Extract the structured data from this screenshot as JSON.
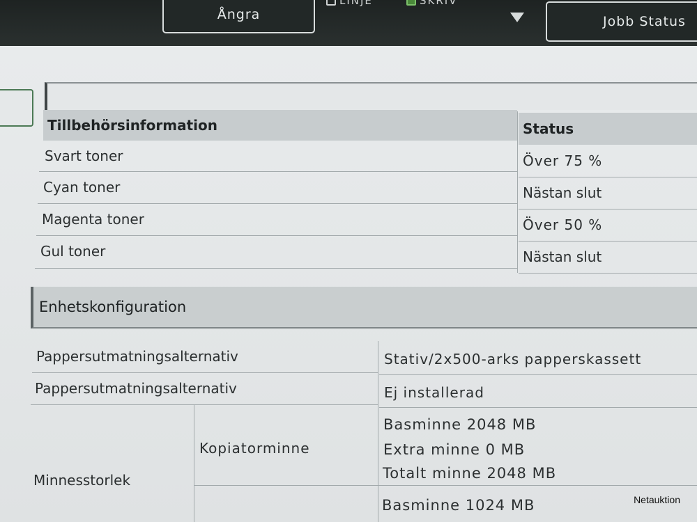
{
  "toolbar": {
    "undo_label": "Ångra",
    "mode_line_label": "LINJE",
    "mode_print_label": "SKRIV",
    "job_status_label": "Jobb Status"
  },
  "supplies": {
    "header_item": "Tillbehörsinformation",
    "header_status": "Status",
    "rows": [
      {
        "item": "Svart toner",
        "status": "Över 75 %"
      },
      {
        "item": "Cyan toner",
        "status": "Nästan slut"
      },
      {
        "item": "Magenta toner",
        "status": "Över 50 %"
      },
      {
        "item": "Gul toner",
        "status": "Nästan slut"
      }
    ]
  },
  "device_config": {
    "title": "Enhetskonfiguration",
    "rows": [
      {
        "label": "Pappersutmatningsalternativ",
        "value": "Stativ/2x500-arks papperskassett"
      },
      {
        "label": "Pappersutmatningsalternativ",
        "value": "Ej installerad"
      }
    ],
    "memory": {
      "label": "Minnesstorlek",
      "copier_label": "Kopiatorminne",
      "copier_values": [
        "Basminne 2048 MB",
        "Extra minne 0 MB",
        "Totalt minne 2048 MB"
      ],
      "second_base": "Basminne 1024 MB"
    }
  },
  "watermark": "Netauktion"
}
